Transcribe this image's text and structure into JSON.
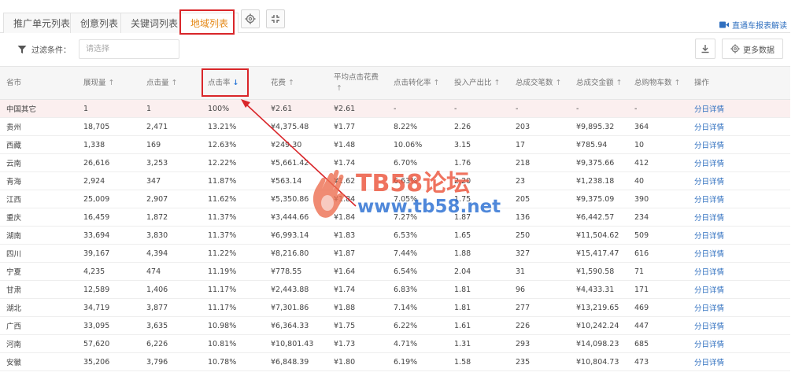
{
  "tabs": [
    {
      "label": "推广单元列表",
      "active": false
    },
    {
      "label": "创意列表",
      "active": false
    },
    {
      "label": "关键词列表",
      "active": false
    },
    {
      "label": "地域列表",
      "active": true
    }
  ],
  "toolbar": {
    "settings_icon": "gear-icon",
    "fullscreen_icon": "collapse-icon",
    "report_link": "直通车报表解读",
    "download_icon": "download-icon",
    "more_data_label": "更多数据"
  },
  "filter": {
    "label": "过滤条件：",
    "placeholder": "请选择"
  },
  "table": {
    "columns": [
      "省市",
      "展现量",
      "点击量",
      "点击率",
      "花费",
      "平均点击花费",
      "点击转化率",
      "投入产出比",
      "总成交笔数",
      "总成交金额",
      "总购物车数",
      "操作"
    ],
    "sorted_column": "点击率",
    "action_label": "分日详情",
    "rows": [
      [
        "中国其它",
        "1",
        "1",
        "100%",
        "¥2.61",
        "¥2.61",
        "-",
        "-",
        "-",
        "-",
        "-"
      ],
      [
        "贵州",
        "18,705",
        "2,471",
        "13.21%",
        "¥4,375.48",
        "¥1.77",
        "8.22%",
        "2.26",
        "203",
        "¥9,895.32",
        "364"
      ],
      [
        "西藏",
        "1,338",
        "169",
        "12.63%",
        "¥249.30",
        "¥1.48",
        "10.06%",
        "3.15",
        "17",
        "¥785.94",
        "10"
      ],
      [
        "云南",
        "26,616",
        "3,253",
        "12.22%",
        "¥5,661.42",
        "¥1.74",
        "6.70%",
        "1.76",
        "218",
        "¥9,375.66",
        "412"
      ],
      [
        "青海",
        "2,924",
        "347",
        "11.87%",
        "¥563.14",
        "¥1.62",
        "6.63%",
        "2.20",
        "23",
        "¥1,238.18",
        "40"
      ],
      [
        "江西",
        "25,009",
        "2,907",
        "11.62%",
        "¥5,350.86",
        "¥1.84",
        "7.05%",
        "1.75",
        "205",
        "¥9,375.09",
        "390"
      ],
      [
        "重庆",
        "16,459",
        "1,872",
        "11.37%",
        "¥3,444.66",
        "¥1.84",
        "7.27%",
        "1.87",
        "136",
        "¥6,442.57",
        "234"
      ],
      [
        "湖南",
        "33,694",
        "3,830",
        "11.37%",
        "¥6,993.14",
        "¥1.83",
        "6.53%",
        "1.65",
        "250",
        "¥11,504.62",
        "509"
      ],
      [
        "四川",
        "39,167",
        "4,394",
        "11.22%",
        "¥8,216.80",
        "¥1.87",
        "7.44%",
        "1.88",
        "327",
        "¥15,417.47",
        "616"
      ],
      [
        "宁夏",
        "4,235",
        "474",
        "11.19%",
        "¥778.55",
        "¥1.64",
        "6.54%",
        "2.04",
        "31",
        "¥1,590.58",
        "71"
      ],
      [
        "甘肃",
        "12,589",
        "1,406",
        "11.17%",
        "¥2,443.88",
        "¥1.74",
        "6.83%",
        "1.81",
        "96",
        "¥4,433.31",
        "171"
      ],
      [
        "湖北",
        "34,719",
        "3,877",
        "11.17%",
        "¥7,301.86",
        "¥1.88",
        "7.14%",
        "1.81",
        "277",
        "¥13,219.65",
        "469"
      ],
      [
        "广西",
        "33,095",
        "3,635",
        "10.98%",
        "¥6,364.33",
        "¥1.75",
        "6.22%",
        "1.61",
        "226",
        "¥10,242.24",
        "447"
      ],
      [
        "河南",
        "57,620",
        "6,226",
        "10.81%",
        "¥10,801.43",
        "¥1.73",
        "4.71%",
        "1.31",
        "293",
        "¥14,098.23",
        "685"
      ],
      [
        "安徽",
        "35,206",
        "3,796",
        "10.78%",
        "¥6,848.39",
        "¥1.80",
        "6.19%",
        "1.58",
        "235",
        "¥10,804.73",
        "473"
      ]
    ]
  },
  "watermark": {
    "title": "TB58论坛",
    "url": "www.tb58.net"
  },
  "colors": {
    "active_tab_text": "#e58a1a",
    "highlight_box": "#d9262a",
    "link": "#2f6fbf",
    "sort_active": "#2f7bd8",
    "highlight_row": "#fbefef"
  }
}
